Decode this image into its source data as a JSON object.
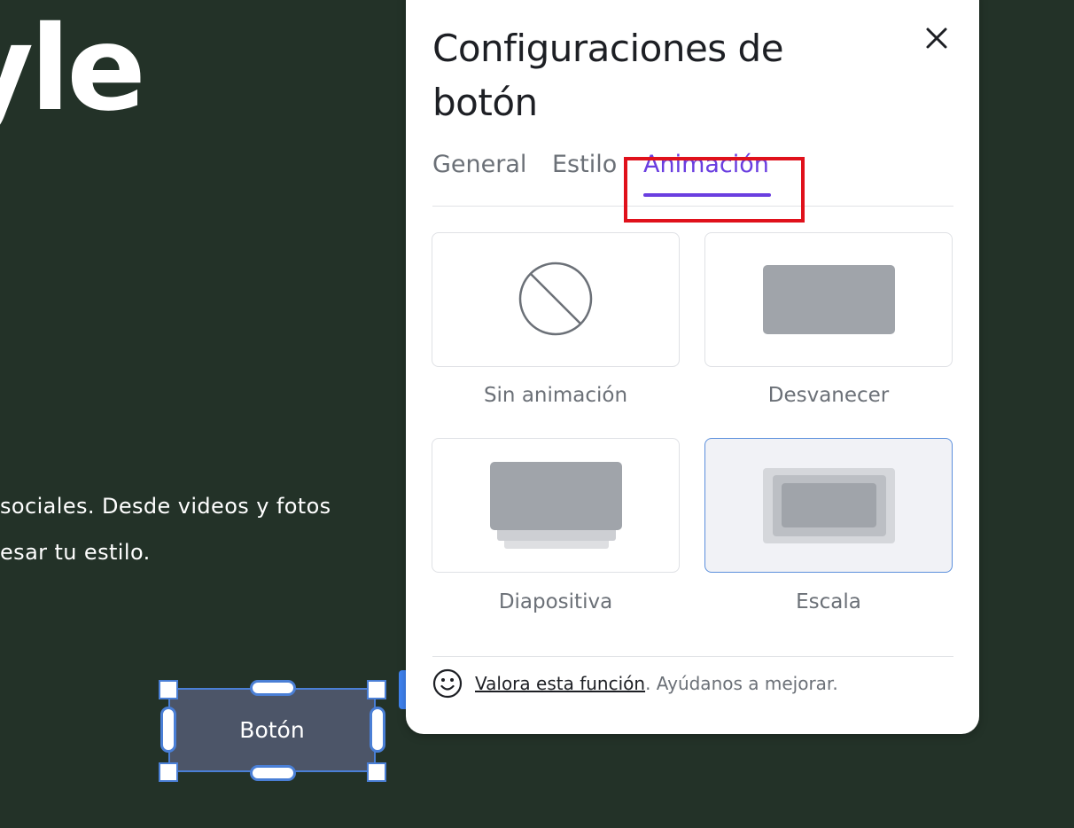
{
  "background": {
    "heading_fragment": "yle",
    "paragraph_lines": [
      "sociales. Desde videos y fotos",
      "esar tu estilo."
    ],
    "selected_button_label": "Botón"
  },
  "modal": {
    "title": "Configuraciones de botón",
    "close_icon": "close-icon",
    "tabs": [
      {
        "label": "General",
        "active": false
      },
      {
        "label": "Estilo",
        "active": false
      },
      {
        "label": "Animación",
        "active": true
      }
    ],
    "animations": [
      {
        "label": "Sin animación",
        "icon": "no-animation-icon",
        "selected": false
      },
      {
        "label": "Desvanecer",
        "icon": "fade-preview-icon",
        "selected": false
      },
      {
        "label": "Diapositiva",
        "icon": "slide-preview-icon",
        "selected": false
      },
      {
        "label": "Escala",
        "icon": "scale-preview-icon",
        "selected": true
      }
    ],
    "footer": {
      "link": "Valora esta función",
      "text": ". Ayúdanos a mejorar."
    }
  },
  "colors": {
    "background": "#233228",
    "accent": "#6a3ee0",
    "highlight": "#e0111b",
    "selection": "#4a7fd6"
  }
}
